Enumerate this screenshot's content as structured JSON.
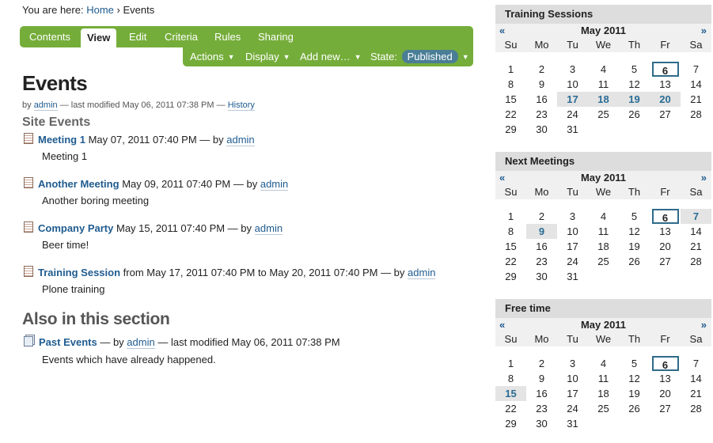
{
  "breadcrumb": {
    "prefix": "You are here:",
    "home": "Home",
    "sep": "›",
    "current": "Events"
  },
  "tabs": [
    "Contents",
    "View",
    "Edit",
    "Criteria",
    "Rules",
    "Sharing"
  ],
  "actions": {
    "actions": "Actions",
    "display": "Display",
    "add_new": "Add new…",
    "state_label": "State:",
    "state_value": "Published",
    "caret": "▼"
  },
  "page": {
    "title": "Events",
    "byline": {
      "by": "by",
      "author": "admin",
      "modified": "— last modified May 06, 2011 07:38 PM —",
      "history": "History"
    },
    "section_title": "Site Events",
    "events": [
      {
        "title": "Meeting 1",
        "meta": "May 07, 2011 07:40 PM — by",
        "author": "admin",
        "description": "Meeting 1"
      },
      {
        "title": "Another Meeting",
        "meta": "May 09, 2011 07:40 PM — by",
        "author": "admin",
        "description": "Another boring meeting"
      },
      {
        "title": "Company Party",
        "meta": "May 15, 2011 07:40 PM — by",
        "author": "admin",
        "description": "Beer time!"
      },
      {
        "title": "Training Session",
        "meta": "from May 17, 2011 07:40 PM to May 20, 2011 07:40 PM — by",
        "author": "admin",
        "description": "Plone training"
      }
    ],
    "also_title": "Also in this section",
    "also": {
      "title": "Past Events",
      "by": "— by",
      "author": "admin",
      "modified": "— last modified May 06, 2011 07:38 PM",
      "description": "Events which have already happened."
    }
  },
  "calendar_common": {
    "month": "May 2011",
    "prev": "«",
    "next": "»",
    "weekdays": [
      "Su",
      "Mo",
      "Tu",
      "We",
      "Th",
      "Fr",
      "Sa"
    ],
    "weeks": [
      [
        "1",
        "2",
        "3",
        "4",
        "5",
        "6",
        "7"
      ],
      [
        "8",
        "9",
        "10",
        "11",
        "12",
        "13",
        "14"
      ],
      [
        "15",
        "16",
        "17",
        "18",
        "19",
        "20",
        "21"
      ],
      [
        "22",
        "23",
        "24",
        "25",
        "26",
        "27",
        "28"
      ],
      [
        "29",
        "30",
        "31",
        "",
        "",
        "",
        ""
      ]
    ],
    "today": "6"
  },
  "calendars": [
    {
      "title": "Training Sessions",
      "event_days": [
        "17",
        "18",
        "19",
        "20"
      ]
    },
    {
      "title": "Next Meetings",
      "event_days": [
        "7",
        "9"
      ]
    },
    {
      "title": "Free time",
      "event_days": [
        "15"
      ]
    }
  ]
}
